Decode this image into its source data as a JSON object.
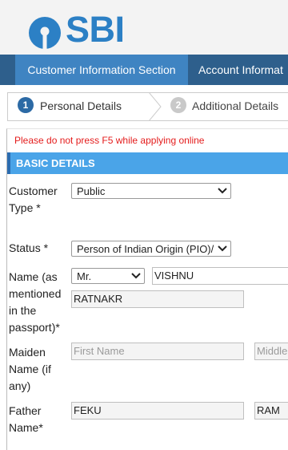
{
  "header": {
    "logo_text": "SBI"
  },
  "tabs": [
    {
      "label": "Customer Information Section"
    },
    {
      "label": "Account Informat"
    }
  ],
  "steps": [
    {
      "number": "1",
      "label": "Personal Details"
    },
    {
      "number": "2",
      "label": "Additional Details"
    }
  ],
  "warning": "Please do not press F5 while applying online",
  "section_title": "BASIC DETAILS",
  "form": {
    "customer_type": {
      "label": "Customer Type *",
      "value": "Public"
    },
    "status": {
      "label": "Status *",
      "value": "Person of Indian Origin (PIO)/"
    },
    "name": {
      "label": "Name (as mentioned in the passport)*",
      "title": "Mr.",
      "first": "VISHNU",
      "last": "RATNAKR"
    },
    "maiden": {
      "label": "Maiden Name (if any)",
      "first_placeholder": "First Name",
      "middle_placeholder": "Middle"
    },
    "father": {
      "label": "Father Name*",
      "first": "FEKU",
      "middle": "RAM"
    }
  },
  "colors": {
    "brand": "#2c80c5",
    "tabbar": "#2e5f8c",
    "active_tab": "#3f84c2",
    "section": "#4aa4e8",
    "warning": "#e41c1c"
  }
}
